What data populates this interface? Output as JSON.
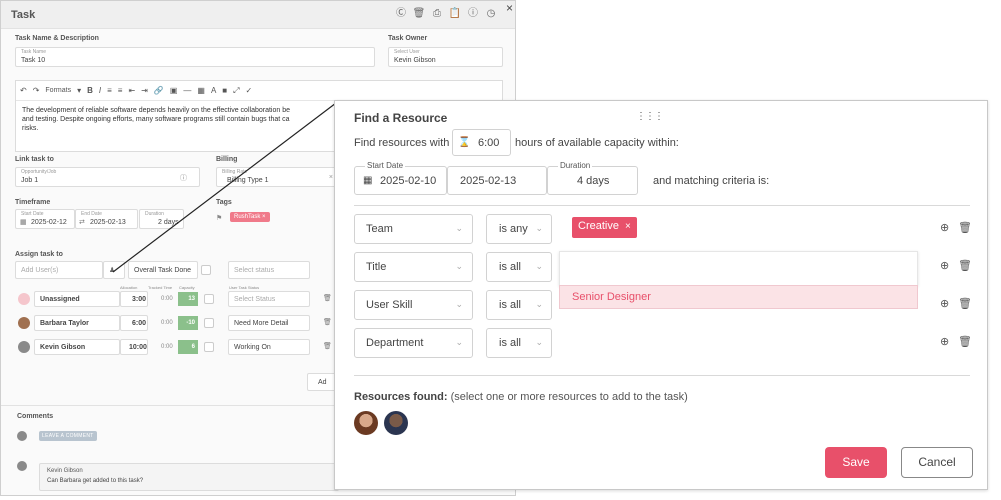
{
  "task_panel": {
    "title": "Task",
    "header_icons": [
      "dollar-icon",
      "trash-icon",
      "print-icon",
      "clipboard-icon",
      "help-icon",
      "clock-icon"
    ],
    "close_label": "×",
    "name_section_label": "Task Name & Description",
    "task_name": {
      "caption": "Task Name",
      "value": "Task 10"
    },
    "owner_section_label": "Task Owner",
    "owner": {
      "caption": "Select User",
      "value": "Kevin Gibson"
    },
    "toolbar": {
      "formats_label": "Formats"
    },
    "description_lines": [
      "The development of reliable software depends heavily on the effective collaboration be",
      "and testing. Despite ongoing efforts, many software programs still contain bugs that ca",
      "risks."
    ],
    "link_task_label": "Link task to",
    "link_field": {
      "caption": "Opportunity/Job",
      "value": "Job 1"
    },
    "billing_label": "Billing",
    "billing_field": {
      "caption": "Billing Rate",
      "value": "Billing Type 1"
    },
    "timeframe_label": "Timeframe",
    "start": {
      "caption": "Start Date",
      "value": "2025-02-12"
    },
    "end": {
      "caption": "End Date",
      "value": "2025-02-13"
    },
    "duration": {
      "caption": "Duration",
      "value": "2 days"
    },
    "tags_label": "Tags",
    "tag": "RushTask",
    "assign_label": "Assign task to",
    "add_users_placeholder": "Add User(s)",
    "overall_done_label": "Overall Task Done",
    "select_status_placeholder": "Select status",
    "col_headers": {
      "allocation": "Allocation",
      "tracked": "Tracked Time",
      "capacity": "Capacity",
      "status": "User Task Status"
    },
    "assignees": [
      {
        "name": "Unassigned",
        "allocation": "3:00",
        "tracked": "0:00",
        "capacity": "13",
        "status": "Select Status"
      },
      {
        "name": "Barbara Taylor",
        "allocation": "6:00",
        "tracked": "0:00",
        "capacity": "-10",
        "status": "Need More Detail"
      },
      {
        "name": "Kevin Gibson",
        "allocation": "10:00",
        "tracked": "0:00",
        "capacity": "6",
        "status": "Working On"
      }
    ],
    "add_button_label": "Ad",
    "comments_label": "Comments",
    "leave_comment_label": "LEAVE A COMMENT",
    "comment": {
      "author": "Kevin Gibson",
      "text": "Can Barbara get added to this task?"
    }
  },
  "dialog": {
    "title": "Find a Resource",
    "find_prefix": "Find resources with",
    "hours_value": "6:00",
    "find_suffix": "hours of available capacity within:",
    "start_date": {
      "caption": "Start Date",
      "value": "2025-02-10"
    },
    "end_date": {
      "value": "2025-02-13"
    },
    "duration": {
      "caption": "Duration",
      "value": "4 days"
    },
    "criteria_text": "and matching criteria is:",
    "criteria": [
      {
        "field": "Team",
        "operator": "is any",
        "chip": "Creative"
      },
      {
        "field": "Title",
        "operator": "is all"
      },
      {
        "field": "User Skill",
        "operator": "is all"
      },
      {
        "field": "Department",
        "operator": "is all"
      }
    ],
    "dropdown_option": "Senior Designer",
    "resources_found_bold": "Resources found:",
    "resources_found_hint": "(select one or more resources to add to the task)",
    "save_label": "Save",
    "cancel_label": "Cancel"
  },
  "colors": {
    "accent": "#e8506a",
    "capacity_green": "#8bc08b",
    "chip_pink": "#f07a8a"
  }
}
